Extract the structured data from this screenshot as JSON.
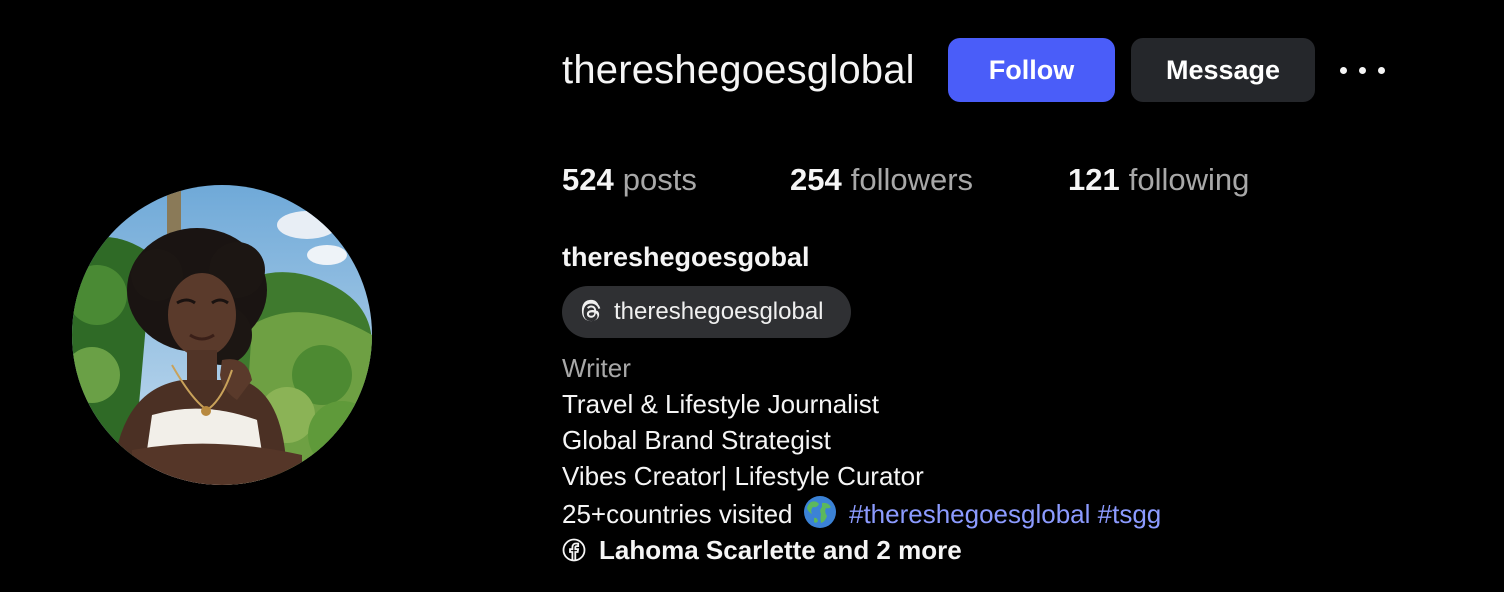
{
  "profile": {
    "username": "thereshegoesglobal",
    "display_name": "thereshegoesgobal",
    "threads_handle": "thereshegoesglobal"
  },
  "actions": {
    "follow_label": "Follow",
    "message_label": "Message",
    "more_icon": "more-horizontal-icon"
  },
  "stats": {
    "posts_count": "524",
    "posts_label": "posts",
    "followers_count": "254",
    "followers_label": "followers",
    "following_count": "121",
    "following_label": "following"
  },
  "bio": {
    "category": "Writer",
    "lines": [
      "Travel & Lifestyle Journalist",
      "Global Brand Strategist",
      "Vibes Creator| Lifestyle Curator"
    ],
    "countries_text": "25+countries visited",
    "globe_icon": "globe-icon",
    "hashtags": [
      "#thereshegoesglobal",
      "#tsgg"
    ],
    "facebook_link": "Lahoma Scarlette and 2 more"
  },
  "colors": {
    "background": "#000000",
    "follow_button": "#4a5df9",
    "message_button": "#25272b",
    "hashtag": "#8c9bff",
    "secondary_text": "#a8a8a8"
  }
}
